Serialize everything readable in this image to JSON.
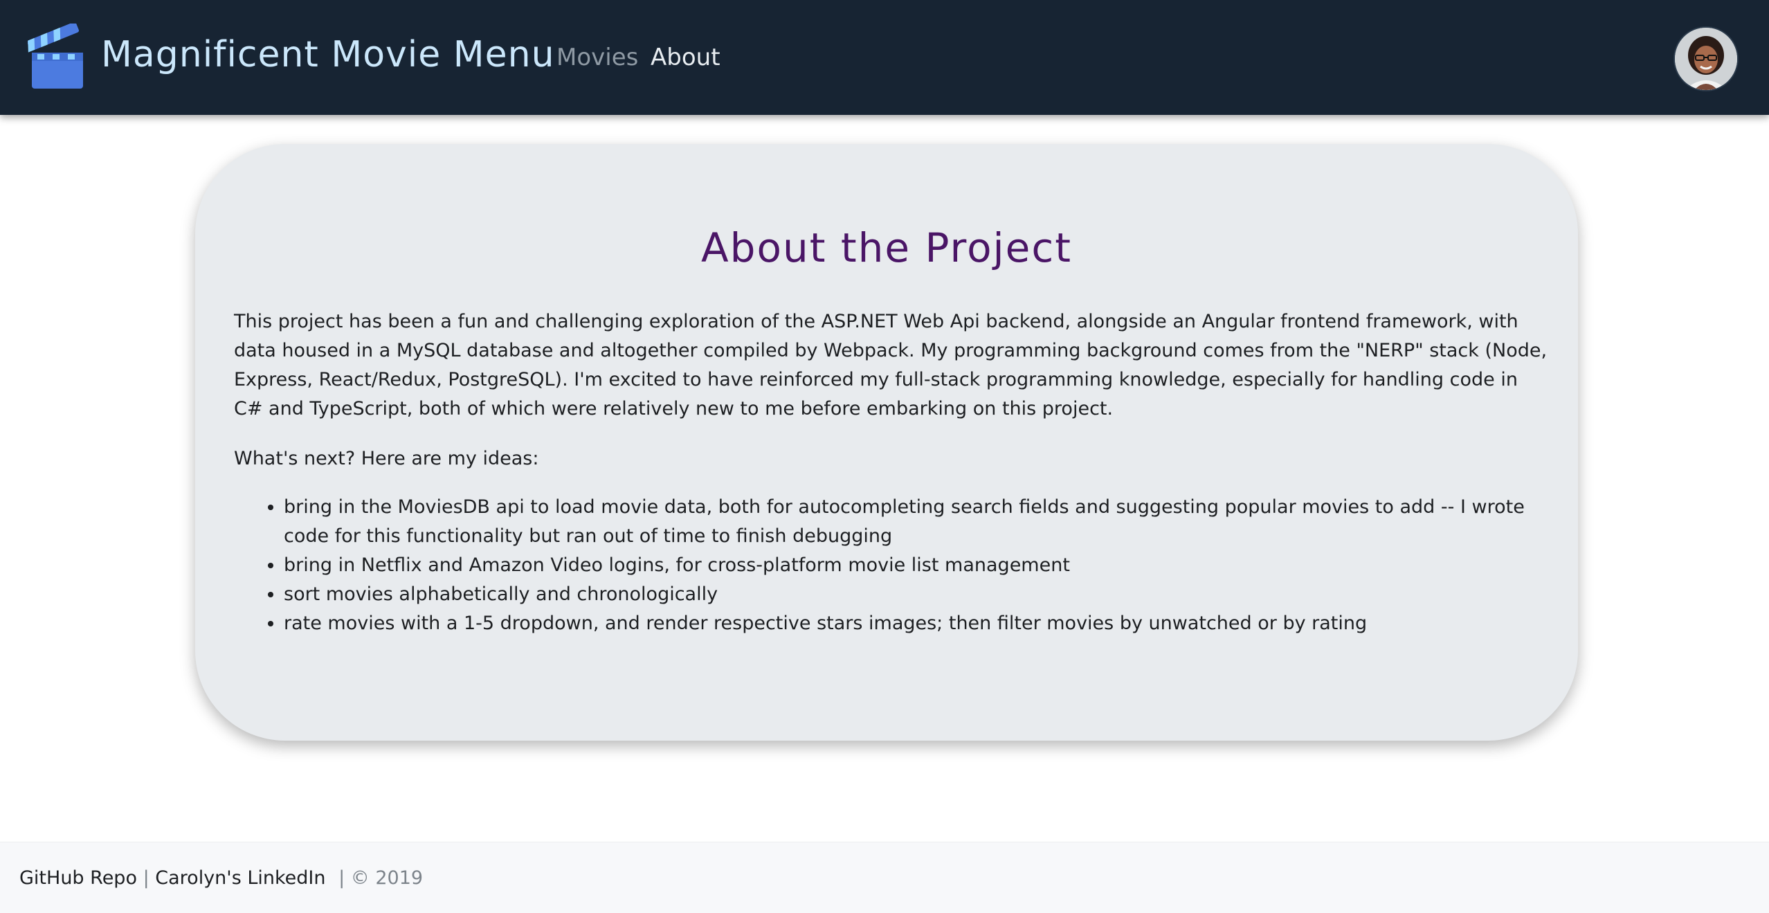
{
  "header": {
    "brand": "Magnificent Movie Menu",
    "logo_icon": "clapperboard-icon",
    "nav": {
      "movies": "Movies",
      "about": "About"
    },
    "avatar_icon": "user-avatar-photo"
  },
  "main": {
    "title": "About the Project",
    "intro": "This project has been a fun and challenging exploration of the ASP.NET Web Api backend, alongside an Angular frontend framework, with data housed in a MySQL database and altogether compiled by Webpack. My programming background comes from the \"NERP\" stack (Node, Express, React/Redux, PostgreSQL). I'm excited to have reinforced my full-stack programming knowledge, especially for handling code in C# and TypeScript, both of which were relatively new to me before embarking on this project.",
    "next_heading": "What's next? Here are my ideas:",
    "ideas": [
      "bring in the MoviesDB api to load movie data, both for autocompleting search fields and suggesting popular movies to add -- I wrote code for this functionality but ran out of time to finish debugging",
      "bring in Netflix and Amazon Video logins, for cross-platform movie list management",
      "sort movies alphabetically and chronologically",
      "rate movies with a 1-5 dropdown, and render respective stars images; then filter movies by unwatched or by rating"
    ]
  },
  "footer": {
    "github": "GitHub Repo",
    "sep": "|",
    "linkedin": "Carolyn's LinkedIn",
    "copyright": "| © 2019"
  },
  "colors": {
    "navbar_bg": "#172433",
    "brand": "#cbe7fb",
    "title": "#4a1566",
    "card_bg": "#e8ebee",
    "footer_bg": "#f7f8fa"
  }
}
